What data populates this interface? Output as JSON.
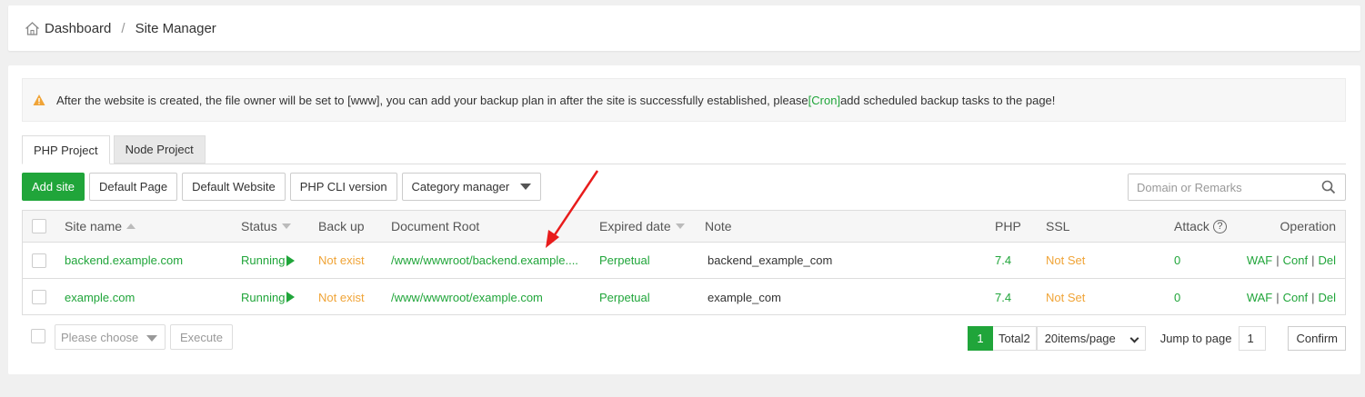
{
  "breadcrumb": {
    "home": "Dashboard",
    "separator": "/",
    "current": "Site Manager"
  },
  "notice": {
    "text_before": "After the website is created, the file owner will be set to [www], you can add your backup plan in after the site is successfully established, please",
    "link": "[Cron]",
    "text_after": "add scheduled backup tasks to the page!"
  },
  "tabs": [
    {
      "label": "PHP Project",
      "active": true
    },
    {
      "label": "Node Project",
      "active": false
    }
  ],
  "toolbar": {
    "add_site": "Add site",
    "default_page": "Default Page",
    "default_website": "Default Website",
    "php_cli": "PHP CLI version",
    "category": "Category manager"
  },
  "search": {
    "placeholder": "Domain or Remarks"
  },
  "table": {
    "headers": {
      "site_name": "Site name",
      "status": "Status",
      "backup": "Back up",
      "root": "Document Root",
      "expired": "Expired date",
      "note": "Note",
      "php": "PHP",
      "ssl": "SSL",
      "attack": "Attack",
      "operation": "Operation"
    },
    "rows": [
      {
        "site": "backend.example.com",
        "status": "Running",
        "backup": "Not exist",
        "root": "/www/wwwroot/backend.example....",
        "expired": "Perpetual",
        "note": "backend_example_com",
        "php": "7.4",
        "ssl": "Not Set",
        "attack": "0",
        "op_waf": "WAF",
        "op_conf": "Conf",
        "op_del": "Del"
      },
      {
        "site": "example.com",
        "status": "Running",
        "backup": "Not exist",
        "root": "/www/wwwroot/example.com",
        "expired": "Perpetual",
        "note": "example_com",
        "php": "7.4",
        "ssl": "Not Set",
        "attack": "0",
        "op_waf": "WAF",
        "op_conf": "Conf",
        "op_del": "Del"
      }
    ]
  },
  "footer": {
    "choose_placeholder": "Please choose",
    "execute": "Execute",
    "page": "1",
    "total": "Total2",
    "per_page": "20items/page",
    "jump_label": "Jump to page",
    "jump_value": "1",
    "confirm": "Confirm"
  },
  "colors": {
    "accent": "#20a53a",
    "warning": "#f0a437",
    "annotation": "#e81c1c"
  }
}
